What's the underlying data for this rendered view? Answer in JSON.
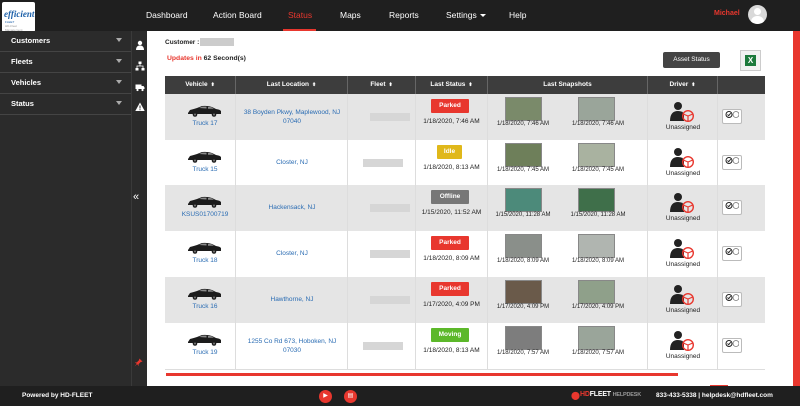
{
  "logo": {
    "line1": "efficient",
    "line2": "FLEET",
    "line3": "HD-Fleet Management"
  },
  "nav": {
    "items": [
      {
        "label": "Dashboard"
      },
      {
        "label": "Action Board"
      },
      {
        "label": "Status"
      },
      {
        "label": "Maps"
      },
      {
        "label": "Reports"
      },
      {
        "label": "Settings"
      },
      {
        "label": "Help"
      }
    ],
    "active": "Status"
  },
  "user": {
    "name": "Michael"
  },
  "sidebar": {
    "items": [
      {
        "label": "Customers"
      },
      {
        "label": "Fleets"
      },
      {
        "label": "Vehicles"
      },
      {
        "label": "Status"
      }
    ]
  },
  "header": {
    "customer_label": "Customer :",
    "updates_prefix": "Updates in",
    "updates_value": "62 Second(s)",
    "asset_button": "Asset Status"
  },
  "table": {
    "columns": [
      "Vehicle",
      "Last Location",
      "Fleet",
      "Last Status",
      "Last Snapshots",
      "Driver"
    ],
    "rows": [
      {
        "vehicle": "Truck 17",
        "location": "38 Boyden Pkwy, Maplewood, NJ 07040",
        "status": "Parked",
        "status_color": "#e8372e",
        "status_time": "1/18/2020, 7:46 AM",
        "snap1": "1/18/2020, 7:46 AM",
        "snap2": "1/18/2020, 7:46 AM",
        "driver": "Unassigned"
      },
      {
        "vehicle": "Truck 15",
        "location": "Closter, NJ",
        "status": "Idle",
        "status_color": "#e0b81a",
        "status_time": "1/18/2020, 8:13 AM",
        "snap1": "1/18/2020, 7:45 AM",
        "snap2": "1/18/2020, 7:45 AM",
        "driver": "Unassigned"
      },
      {
        "vehicle": "KSUS01700719",
        "location": "Hackensack, NJ",
        "status": "Offline",
        "status_color": "#777777",
        "status_time": "1/15/2020, 11:52 AM",
        "snap1": "1/15/2020, 11:28 AM",
        "snap2": "1/15/2020, 11:28 AM",
        "driver": "Unassigned"
      },
      {
        "vehicle": "Truck 18",
        "location": "Closter, NJ",
        "status": "Parked",
        "status_color": "#e8372e",
        "status_time": "1/18/2020, 8:09 AM",
        "snap1": "1/18/2020, 8:09 AM",
        "snap2": "1/18/2020, 8:09 AM",
        "driver": "Unassigned"
      },
      {
        "vehicle": "Truck 16",
        "location": "Hawthorne, NJ",
        "status": "Parked",
        "status_color": "#e8372e",
        "status_time": "1/17/2020, 4:09 PM",
        "snap1": "1/17/2020, 4:09 PM",
        "snap2": "1/17/2020, 4:09 PM",
        "driver": "Unassigned"
      },
      {
        "vehicle": "Truck 19",
        "location": "1255 Co Rd 673, Hoboken, NJ 07030",
        "status": "Moving",
        "status_color": "#5cb82a",
        "status_time": "1/18/2020, 8:13 AM",
        "snap1": "1/18/2020, 7:57 AM",
        "snap2": "1/18/2020, 7:57 AM",
        "driver": "Unassigned"
      }
    ]
  },
  "footer": {
    "powered": "Powered by HD-FLEET",
    "brand_red": "HD",
    "brand_white": "FLEET",
    "brand_sub": "HELPDESK",
    "contact": "833-433-5338 | helpdesk@hdfleet.com"
  },
  "colors": {
    "accent": "#e8372e",
    "link": "#2a6cb3",
    "header_bg": "#1f1f1f"
  }
}
